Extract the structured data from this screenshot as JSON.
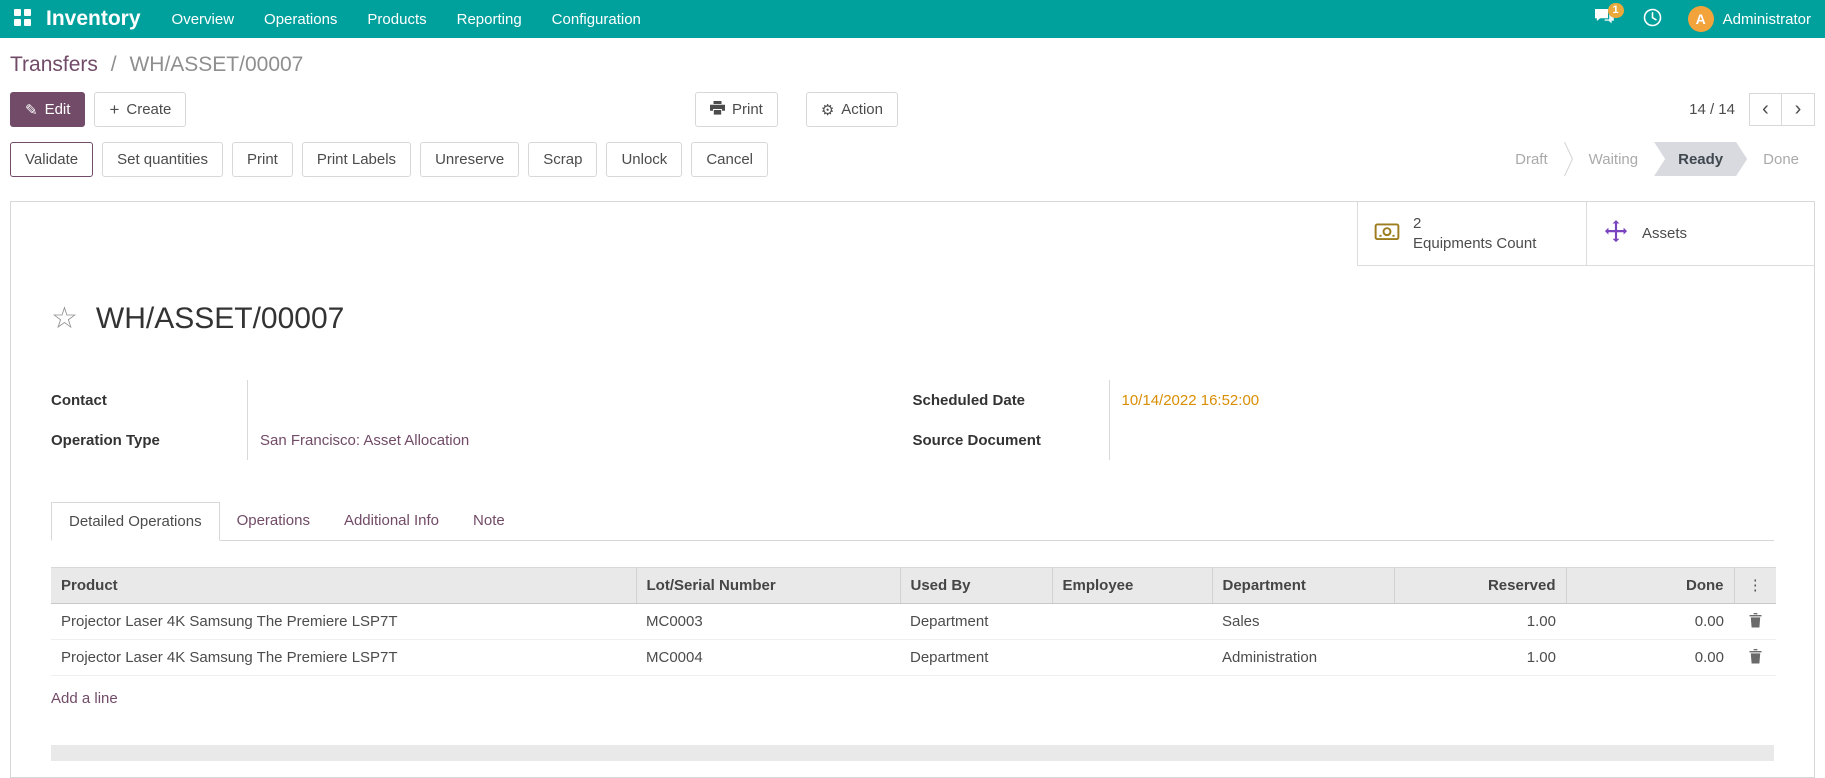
{
  "colors": {
    "navbar_bg": "#00A09D",
    "primary": "#714B67",
    "link": "#714B67",
    "scheduled_date_text": "#D98E04",
    "equipment_icon": "#9C7C1E",
    "assets_icon": "#7A44BE",
    "statusbar_active_bg": "#D8DADF",
    "avatar_bg": "#F2A33C"
  },
  "icons": {
    "edit": "✎",
    "create": "+",
    "action_gear": "⚙",
    "star": "☆",
    "column_options": "⋮",
    "pager_prev": "‹",
    "pager_next": "›"
  },
  "header": {
    "app_name": "Inventory",
    "menu": [
      "Overview",
      "Operations",
      "Products",
      "Reporting",
      "Configuration"
    ],
    "messages_badge": "1",
    "user": {
      "initial": "A",
      "name": "Administrator"
    }
  },
  "breadcrumb": {
    "parent": "Transfers",
    "separator": "/",
    "current": "WH/ASSET/00007"
  },
  "control_panel": {
    "edit_label": "Edit",
    "create_label": "Create",
    "print_label": "Print",
    "action_label": "Action",
    "pager": {
      "text": "14 / 14"
    }
  },
  "status_buttons": [
    "Validate",
    "Set quantities",
    "Print",
    "Print Labels",
    "Unreserve",
    "Scrap",
    "Unlock",
    "Cancel"
  ],
  "statusbar": {
    "steps": [
      {
        "label": "Draft",
        "active": false
      },
      {
        "label": "Waiting",
        "active": false
      },
      {
        "label": "Ready",
        "active": true
      },
      {
        "label": "Done",
        "active": false
      }
    ]
  },
  "smart_buttons": {
    "equipments": {
      "value": "2",
      "label": "Equipments Count"
    },
    "assets": {
      "label": "Assets"
    }
  },
  "sheet": {
    "title": "WH/ASSET/00007",
    "fields": {
      "contact": {
        "label": "Contact",
        "value": ""
      },
      "operation_type": {
        "label": "Operation Type",
        "value": "San Francisco: Asset Allocation"
      },
      "scheduled_date": {
        "label": "Scheduled Date",
        "value": "10/14/2022 16:52:00"
      },
      "source_document": {
        "label": "Source Document",
        "value": ""
      }
    },
    "tabs": [
      {
        "label": "Detailed Operations",
        "active": true
      },
      {
        "label": "Operations",
        "active": false
      },
      {
        "label": "Additional Info",
        "active": false
      },
      {
        "label": "Note",
        "active": false
      }
    ],
    "table": {
      "columns": [
        "Product",
        "Lot/Serial Number",
        "Used By",
        "Employee",
        "Department",
        "Reserved",
        "Done"
      ],
      "rows": [
        {
          "product": "Projector Laser 4K Samsung The Premiere LSP7T",
          "lot_serial": "MC0003",
          "used_by": "Department",
          "employee": "",
          "department": "Sales",
          "reserved": "1.00",
          "done": "0.00"
        },
        {
          "product": "Projector Laser 4K Samsung The Premiere LSP7T",
          "lot_serial": "MC0004",
          "used_by": "Department",
          "employee": "",
          "department": "Administration",
          "reserved": "1.00",
          "done": "0.00"
        }
      ],
      "add_line_label": "Add a line"
    }
  }
}
